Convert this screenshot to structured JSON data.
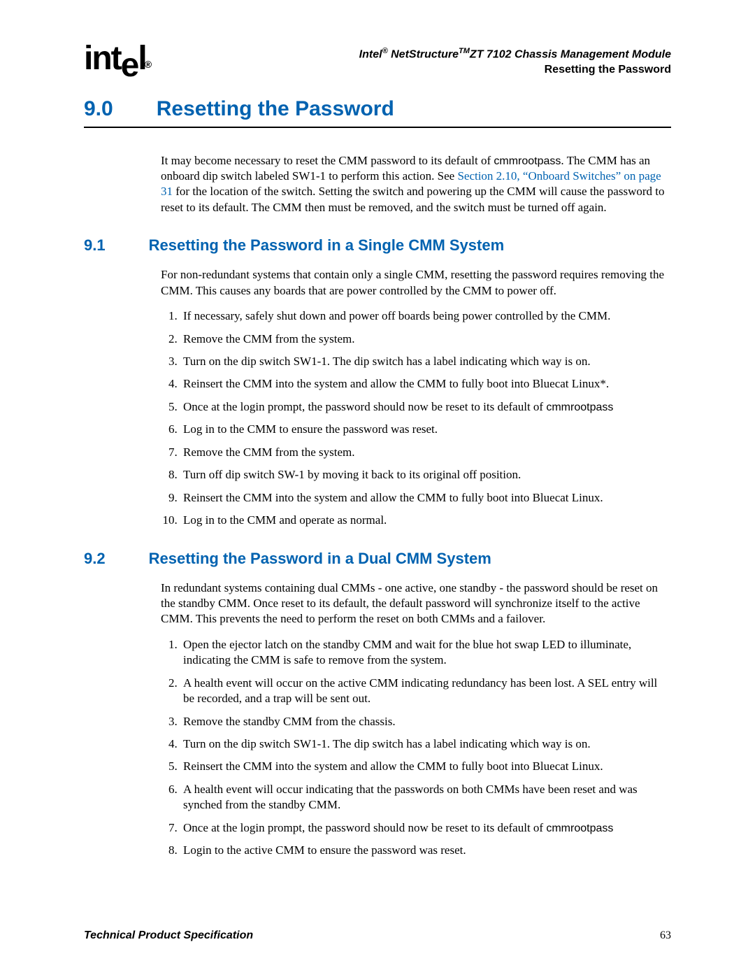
{
  "header": {
    "logo_text_html": "int<span class=\"dropped\">e</span>l<span class=\"reg\">®</span>",
    "product_line_html": "Intel<span class=\"reg\">®</span> NetStructure<span class=\"tm\">TM</span>ZT 7102 Chassis Management Module",
    "section_title": "Resetting the Password"
  },
  "h1": {
    "num": "9.0",
    "title": "Resetting the Password"
  },
  "intro": {
    "text_html": "It may become necessary to reset the CMM password to its default of <span class=\"mono\">cmmrootpass</span>. The CMM has an onboard dip switch labeled SW1-1 to perform this action. See <a href=\"#\" class=\"xref\" data-name=\"cross-reference-link\" data-interactable=\"true\">Section 2.10, “Onboard Switches” on page 31</a> for the location of the switch. Setting the switch and powering up the CMM will cause the password to reset to its default. The CMM then must be removed, and the switch must be turned off again."
  },
  "s91": {
    "num": "9.1",
    "title": "Resetting the Password in a Single CMM System",
    "para": "For non-redundant systems that contain only a single CMM, resetting the password requires removing the CMM. This causes any boards that are power controlled by the CMM to power off.",
    "steps": [
      "If necessary, safely shut down and power off boards being power controlled by the CMM.",
      "Remove the CMM from the system.",
      "Turn on the dip switch SW1-1. The dip switch has a label indicating which way is on.",
      "Reinsert the CMM into the system and allow the CMM to fully boot into Bluecat Linux*.",
      "Once at the login prompt, the password should now be reset to its default of <span class=\"mono\">cmmrootpass</span>",
      "Log in to the CMM to ensure the password was reset.",
      "Remove the CMM from the system.",
      "Turn off dip switch SW-1 by moving it back to its original off position.",
      "Reinsert the CMM into the system and allow the CMM to fully boot into Bluecat Linux.",
      "Log in to the CMM and operate as normal."
    ]
  },
  "s92": {
    "num": "9.2",
    "title": "Resetting the Password in a Dual CMM System",
    "para": "In redundant systems containing dual CMMs - one active, one standby - the password should be reset on the standby CMM. Once reset to its default, the default password will synchronize itself to the active CMM. This prevents the need to perform the reset on both CMMs and a failover.",
    "steps": [
      "Open the ejector latch on the standby CMM and wait for the blue hot swap LED to illuminate, indicating the CMM is safe to remove from the system.",
      "A health event will occur on the active CMM indicating redundancy has been lost. A SEL entry will be recorded, and a trap will be sent out.",
      "Remove the standby CMM from the chassis.",
      "Turn on the dip switch SW1-1. The dip switch has a label indicating which way is on.",
      "Reinsert the CMM into the system and allow the CMM to fully boot into Bluecat Linux.",
      "A health event will occur indicating that the passwords on both CMMs have been reset and was synched from the standby CMM.",
      "Once at the login prompt, the password should now be reset to its default of <span class=\"mono\">cmmrootpass</span>",
      "Login to the active CMM to ensure the password was reset."
    ]
  },
  "footer": {
    "left": "Technical Product Specification",
    "page": "63"
  }
}
